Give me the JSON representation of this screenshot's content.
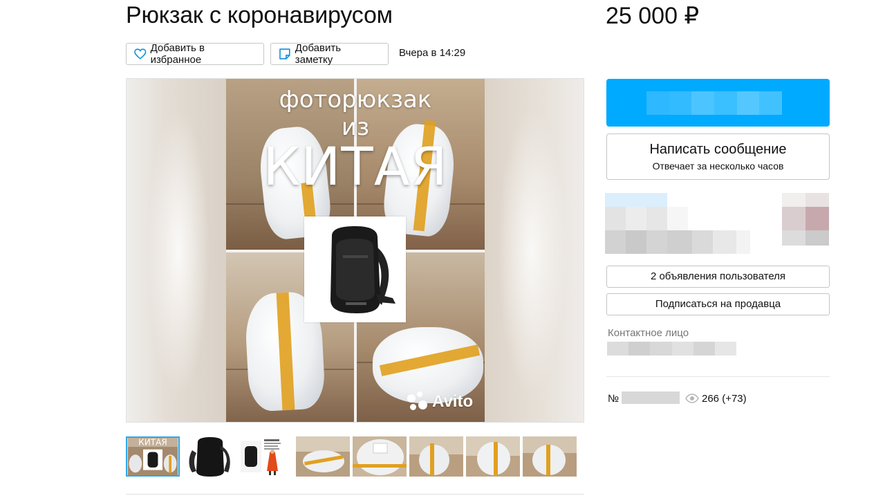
{
  "listing": {
    "title": "Рюкзак с коронавирусом",
    "price": "25 000 ₽",
    "date": "Вчера в 14:29"
  },
  "actions": {
    "favorite_label": "Добавить в избранное",
    "note_label": "Добавить заметку"
  },
  "gallery": {
    "overlay_line1": "фоторюкзак",
    "overlay_line2": "из",
    "overlay_line3": "КИТАЯ",
    "watermark": "Avito",
    "thumbnail_count": 8,
    "active_thumbnail": 1
  },
  "sidebar": {
    "message_button": "Написать сообщение",
    "message_subtitle": "Отвечает за несколько часов",
    "user_ads_button": "2 объявления пользователя",
    "subscribe_button": "Подписаться на продавца",
    "contact_label": "Контактное лицо",
    "ad_number_prefix": "№",
    "views": "266 (+73)"
  },
  "colors": {
    "accent_blue": "#00aaff",
    "thumb_active_border": "#2ea7e6",
    "muted_text": "#767676"
  }
}
